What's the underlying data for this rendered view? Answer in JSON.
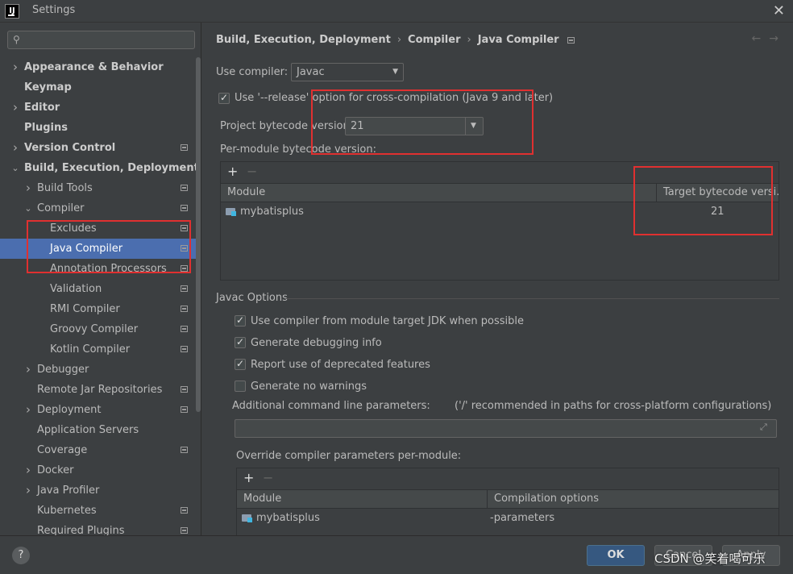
{
  "window": {
    "title": "Settings",
    "app_icon_text": "IJ"
  },
  "sidebar": {
    "search_placeholder": "",
    "items": [
      {
        "label": "Appearance & Behavior",
        "level": 0,
        "expandable": true,
        "expanded": false,
        "bold": true,
        "badge": false
      },
      {
        "label": "Keymap",
        "level": 0,
        "expandable": false,
        "bold": true,
        "badge": false
      },
      {
        "label": "Editor",
        "level": 0,
        "expandable": true,
        "expanded": false,
        "bold": true,
        "badge": false
      },
      {
        "label": "Plugins",
        "level": 0,
        "expandable": false,
        "bold": true,
        "badge": false
      },
      {
        "label": "Version Control",
        "level": 0,
        "expandable": true,
        "expanded": false,
        "bold": true,
        "badge": true
      },
      {
        "label": "Build, Execution, Deployment",
        "level": 0,
        "expandable": true,
        "expanded": true,
        "bold": true,
        "badge": false
      },
      {
        "label": "Build Tools",
        "level": 1,
        "expandable": true,
        "expanded": false,
        "badge": true
      },
      {
        "label": "Compiler",
        "level": 1,
        "expandable": true,
        "expanded": true,
        "badge": true
      },
      {
        "label": "Excludes",
        "level": 2,
        "expandable": false,
        "badge": true
      },
      {
        "label": "Java Compiler",
        "level": 2,
        "expandable": false,
        "badge": true,
        "selected": true
      },
      {
        "label": "Annotation Processors",
        "level": 2,
        "expandable": false,
        "badge": true
      },
      {
        "label": "Validation",
        "level": 2,
        "expandable": false,
        "badge": true
      },
      {
        "label": "RMI Compiler",
        "level": 2,
        "expandable": false,
        "badge": true
      },
      {
        "label": "Groovy Compiler",
        "level": 2,
        "expandable": false,
        "badge": true
      },
      {
        "label": "Kotlin Compiler",
        "level": 2,
        "expandable": false,
        "badge": true
      },
      {
        "label": "Debugger",
        "level": 1,
        "expandable": true,
        "expanded": false,
        "badge": false
      },
      {
        "label": "Remote Jar Repositories",
        "level": 1,
        "expandable": false,
        "badge": true
      },
      {
        "label": "Deployment",
        "level": 1,
        "expandable": true,
        "expanded": false,
        "badge": true
      },
      {
        "label": "Application Servers",
        "level": 1,
        "expandable": false,
        "badge": false
      },
      {
        "label": "Coverage",
        "level": 1,
        "expandable": false,
        "badge": true
      },
      {
        "label": "Docker",
        "level": 1,
        "expandable": true,
        "expanded": false,
        "badge": false
      },
      {
        "label": "Java Profiler",
        "level": 1,
        "expandable": true,
        "expanded": false,
        "badge": false
      },
      {
        "label": "Kubernetes",
        "level": 1,
        "expandable": false,
        "badge": true
      },
      {
        "label": "Required Plugins",
        "level": 1,
        "expandable": false,
        "badge": true
      }
    ]
  },
  "breadcrumb": {
    "part1": "Build, Execution, Deployment",
    "part2": "Compiler",
    "part3": "Java Compiler",
    "separator": "›"
  },
  "nav": {
    "back": "←",
    "forward": "→"
  },
  "compiler": {
    "use_compiler_label": "Use compiler:",
    "use_compiler_value": "Javac",
    "release_option_label": "Use '--release' option for cross-compilation (Java 9 and later)",
    "release_option_checked": true,
    "bytecode_label": "Project bytecode version:",
    "bytecode_value": "21",
    "per_module_label": "Per-module bytecode version:"
  },
  "module_table": {
    "columns": [
      "Module",
      "Target bytecode versi..."
    ],
    "rows": [
      {
        "module": "mybatisplus",
        "version": "21"
      }
    ]
  },
  "javac": {
    "section_title": "Javac Options",
    "options": [
      {
        "label": "Use compiler from module target JDK when possible",
        "checked": true
      },
      {
        "label": "Generate debugging info",
        "checked": true
      },
      {
        "label": "Report use of deprecated features",
        "checked": true
      },
      {
        "label": "Generate no warnings",
        "checked": false
      }
    ],
    "additional_params_label": "Additional command line parameters:",
    "additional_params_hint": "('/' recommended in paths for cross-platform configurations)",
    "additional_params_value": "",
    "override_label": "Override compiler parameters per-module:"
  },
  "override_table": {
    "columns": [
      "Module",
      "Compilation options"
    ],
    "rows": [
      {
        "module": "mybatisplus",
        "options": "-parameters"
      }
    ]
  },
  "table_toolbar": {
    "add": "+",
    "remove": "−"
  },
  "footer": {
    "help": "?",
    "ok": "OK",
    "cancel": "Cancel",
    "apply": "Apply"
  },
  "watermark": "CSDN @笑着喝可乐",
  "colors": {
    "selection": "#4b6eaf",
    "annotation_red": "#e03030",
    "ok_button": "#365880"
  }
}
